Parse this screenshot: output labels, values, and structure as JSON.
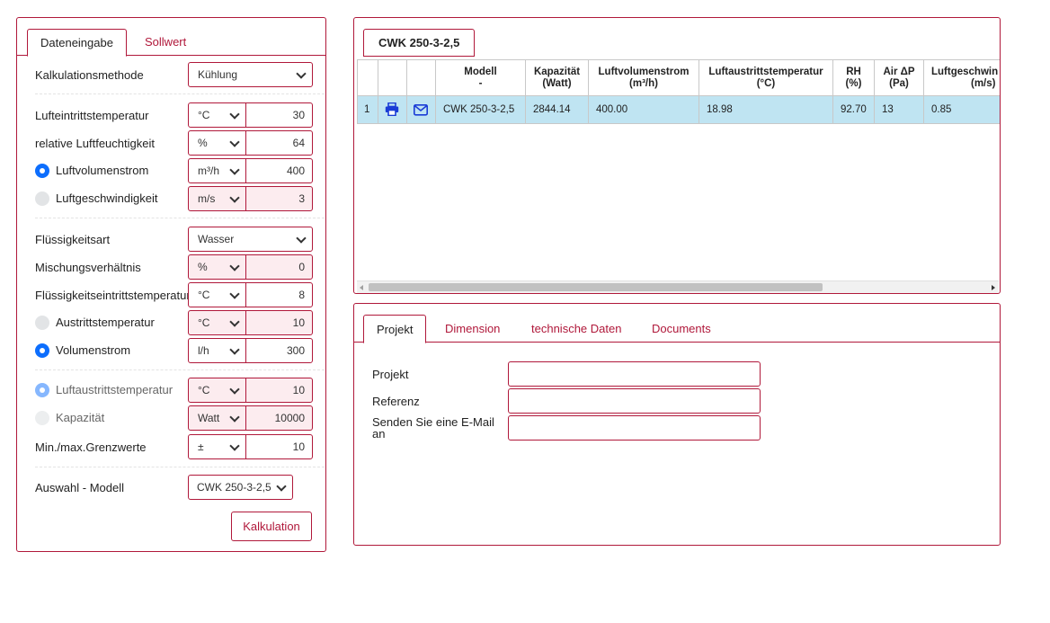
{
  "left_panel": {
    "tabs": [
      "Dateneingabe",
      "Sollwert"
    ],
    "kalkulationsmethode": {
      "label": "Kalkulationsmethode",
      "value": "Kühlung"
    },
    "lufteintritt": {
      "label": "Lufteintrittstemperatur",
      "unit": "°C",
      "value": "30"
    },
    "luftfeuchtigkeit": {
      "label": "relative Luftfeuchtigkeit",
      "unit": "%",
      "value": "64"
    },
    "luftvolumenstrom": {
      "label": "Luftvolumenstrom",
      "unit": "m³/h",
      "value": "400",
      "selected": true
    },
    "luftgeschwindigkeit": {
      "label": "Luftgeschwindigkeit",
      "unit": "m/s",
      "value": "3",
      "selected": false
    },
    "fluessigkeitsart": {
      "label": "Flüssigkeitsart",
      "value": "Wasser"
    },
    "mischungsverhaeltnis": {
      "label": "Mischungsverhältnis",
      "unit": "%",
      "value": "0"
    },
    "fluessigkeitseintritt": {
      "label": "Flüssigkeitseintrittstemperatur",
      "unit": "°C",
      "value": "8"
    },
    "austrittstemperatur": {
      "label": "Austrittstemperatur",
      "unit": "°C",
      "value": "10",
      "selected": false
    },
    "volumenstrom": {
      "label": "Volumenstrom",
      "unit": "l/h",
      "value": "300",
      "selected": true
    },
    "luftaustritt": {
      "label": "Luftaustrittstemperatur",
      "unit": "°C",
      "value": "10"
    },
    "kapazitaet": {
      "label": "Kapazität",
      "unit": "Watt",
      "value": "10000"
    },
    "grenzwerte": {
      "label": "Min./max.Grenzwerte",
      "unit": "±",
      "value": "10"
    },
    "auswahl_modell": {
      "label": "Auswahl - Modell",
      "value": "CWK 250-3-2,5"
    },
    "kalkulation_button": "Kalkulation"
  },
  "results_panel": {
    "tab": "CWK 250-3-2,5",
    "columns": [
      {
        "line1": "",
        "line2": ""
      },
      {
        "line1": "",
        "line2": ""
      },
      {
        "line1": "",
        "line2": ""
      },
      {
        "line1": "Modell",
        "line2": "-"
      },
      {
        "line1": "Kapazität",
        "line2": "(Watt)"
      },
      {
        "line1": "Luftvolumenstrom",
        "line2": "(m³/h)"
      },
      {
        "line1": "Luftaustrittstemperatur",
        "line2": "(°C)"
      },
      {
        "line1": "RH",
        "line2": "(%)"
      },
      {
        "line1": "Air ΔP",
        "line2": "(Pa)"
      },
      {
        "line1": "Luftgeschwin",
        "line2": "(m/s)"
      }
    ],
    "row": {
      "index": "1",
      "print_icon": "printer-icon",
      "mail_icon": "envelope-icon",
      "modell": "CWK 250-3-2,5",
      "kapazitaet": "2844.14",
      "luftvolumenstrom": "400.00",
      "luftaustrittstemperatur": "18.98",
      "rh": "92.70",
      "air_dp": "13",
      "luftgeschwindigkeit": "0.85"
    }
  },
  "details_panel": {
    "tabs": [
      "Projekt",
      "Dimension",
      "technische Daten",
      "Documents"
    ],
    "fields": [
      {
        "label": "Projekt",
        "value": ""
      },
      {
        "label": "Referenz",
        "value": ""
      },
      {
        "label": "Senden Sie eine E-Mail an",
        "value": ""
      }
    ]
  },
  "colors": {
    "accent": "#b0183a",
    "selected_row": "#bfe4f2",
    "disabled_field": "#fcecef",
    "radio_on": "#0d6efd"
  }
}
